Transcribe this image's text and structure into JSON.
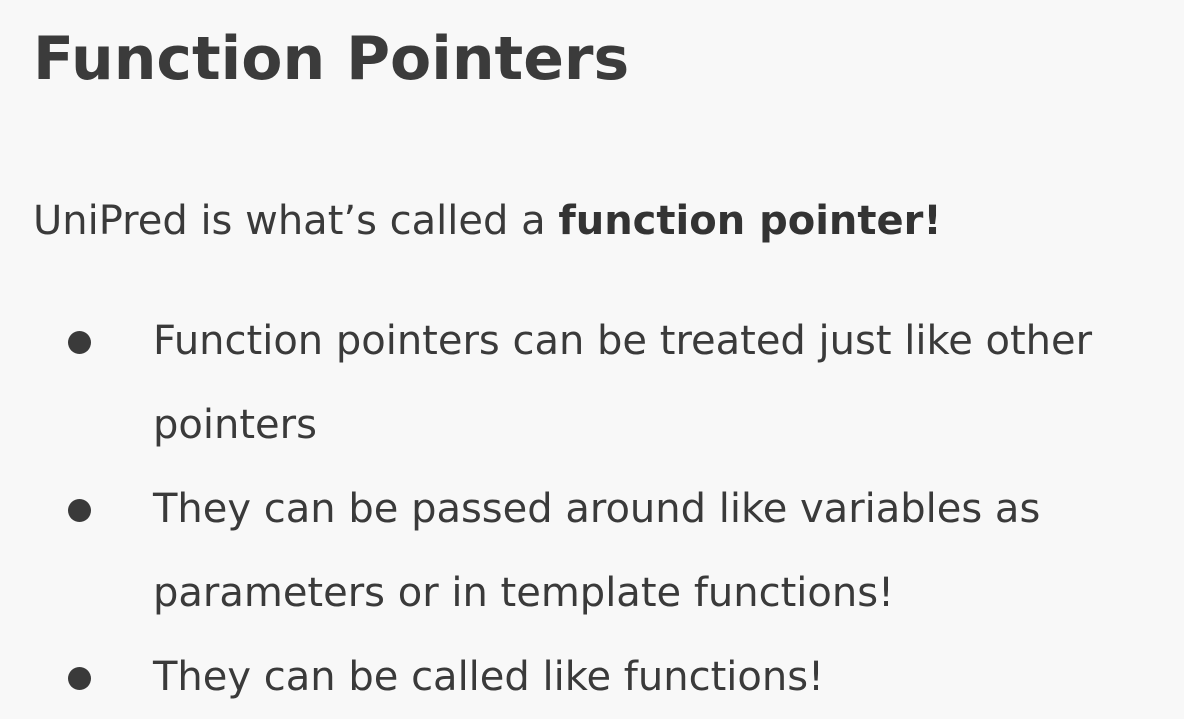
{
  "slide": {
    "title": "Function Pointers",
    "intro": {
      "prefix": "UniPred is what’s called a ",
      "emphasis": "function pointer!"
    },
    "bullets": [
      {
        "line1": "Function pointers can be treated just like other",
        "line2": "pointers"
      },
      {
        "line1": "They can be passed around like variables as",
        "line2": "parameters or in template functions!"
      },
      {
        "line1": "They can be called like functions!",
        "line2": ""
      }
    ]
  }
}
